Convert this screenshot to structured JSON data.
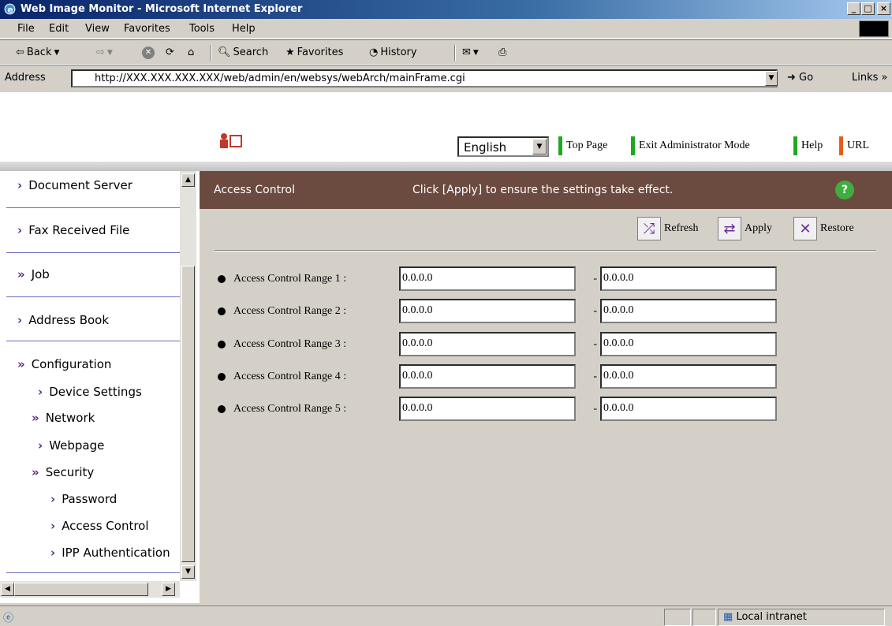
{
  "window": {
    "title": "Web Image Monitor - Microsoft Internet Explorer",
    "controls": [
      "_",
      "□",
      "×"
    ]
  },
  "menu": {
    "items": [
      "File",
      "Edit",
      "View",
      "Favorites",
      "Tools",
      "Help"
    ]
  },
  "toolbar": {
    "back": "Back",
    "search": "Search",
    "favorites": "Favorites",
    "history": "History"
  },
  "address": {
    "label": "Address",
    "url": "http://XXX.XXX.XXX.XXX/web/admin/en/websys/webArch/mainFrame.cgi",
    "go": "Go",
    "links": "Links"
  },
  "header": {
    "language": "English",
    "links": [
      {
        "label": "Top Page",
        "color": "#1fa81f"
      },
      {
        "label": "Exit Administrator Mode",
        "color": "#1fa81f"
      },
      {
        "label": "Help",
        "color": "#1fa81f"
      },
      {
        "label": "URL",
        "color": "#e85a1c"
      }
    ]
  },
  "sidebar": {
    "items": [
      {
        "label": "Document Server",
        "chevron": "›"
      },
      {
        "label": "Fax Received File",
        "chevron": "›"
      },
      {
        "label": "Job",
        "chevron": "»"
      },
      {
        "label": "Address Book",
        "chevron": "›"
      },
      {
        "label": "Configuration",
        "chevron": "»"
      }
    ],
    "subitems": [
      {
        "label": "Device Settings",
        "chevron": "›"
      },
      {
        "label": "Network",
        "chevron": "»"
      },
      {
        "label": "Webpage",
        "chevron": "›"
      },
      {
        "label": "Security",
        "chevron": "»"
      },
      {
        "label": "Password",
        "chevron": "›"
      },
      {
        "label": "Access Control",
        "chevron": "›"
      },
      {
        "label": "IPP Authentication",
        "chevron": "›"
      }
    ]
  },
  "main": {
    "title": "Access Control",
    "instruction": "Click [Apply] to ensure the settings take effect.",
    "actions": {
      "refresh": "Refresh",
      "apply": "Apply",
      "restore": "Restore"
    },
    "ranges": [
      {
        "label": "Access Control Range 1 :",
        "start": "0.0.0.0",
        "end": "0.0.0.0"
      },
      {
        "label": "Access Control Range 2 :",
        "start": "0.0.0.0",
        "end": "0.0.0.0"
      },
      {
        "label": "Access Control Range 3 :",
        "start": "0.0.0.0",
        "end": "0.0.0.0"
      },
      {
        "label": "Access Control Range 4 :",
        "start": "0.0.0.0",
        "end": "0.0.0.0"
      },
      {
        "label": "Access Control Range 5 :",
        "start": "0.0.0.0",
        "end": "0.0.0.0"
      }
    ],
    "range_separator": "-"
  },
  "status": {
    "zone": "Local intranet"
  }
}
